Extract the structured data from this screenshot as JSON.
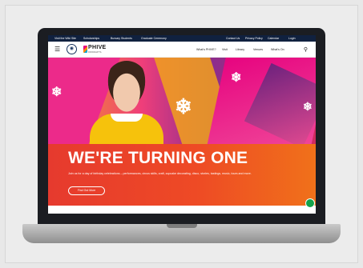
{
  "utility_bar": {
    "items": [
      "Visit the Wiki Site",
      "Scholarships",
      "Bursary Students",
      "Graduate Ceremony"
    ],
    "right_items": [
      "Contact Us",
      "Privacy Policy",
      "Calendar",
      "Login"
    ]
  },
  "nav": {
    "brand": "PHIVE",
    "brand_sub": "PARRAMATTA",
    "links": [
      "What's PHIVE?",
      "Visit",
      "Library",
      "Venues",
      "What's On"
    ]
  },
  "hero": {
    "headline": "WE'RE TURNING ONE",
    "subtext": "Join us for a day of birthday celebrations – performances, circus skills, craft, cupcake decorating, disco, stories, tastings, music, tours and more.",
    "cta_label": "Find Out More"
  },
  "colors": {
    "accent": "#ef3e7a",
    "band": "#ee4a25",
    "utility": "#10213f"
  }
}
